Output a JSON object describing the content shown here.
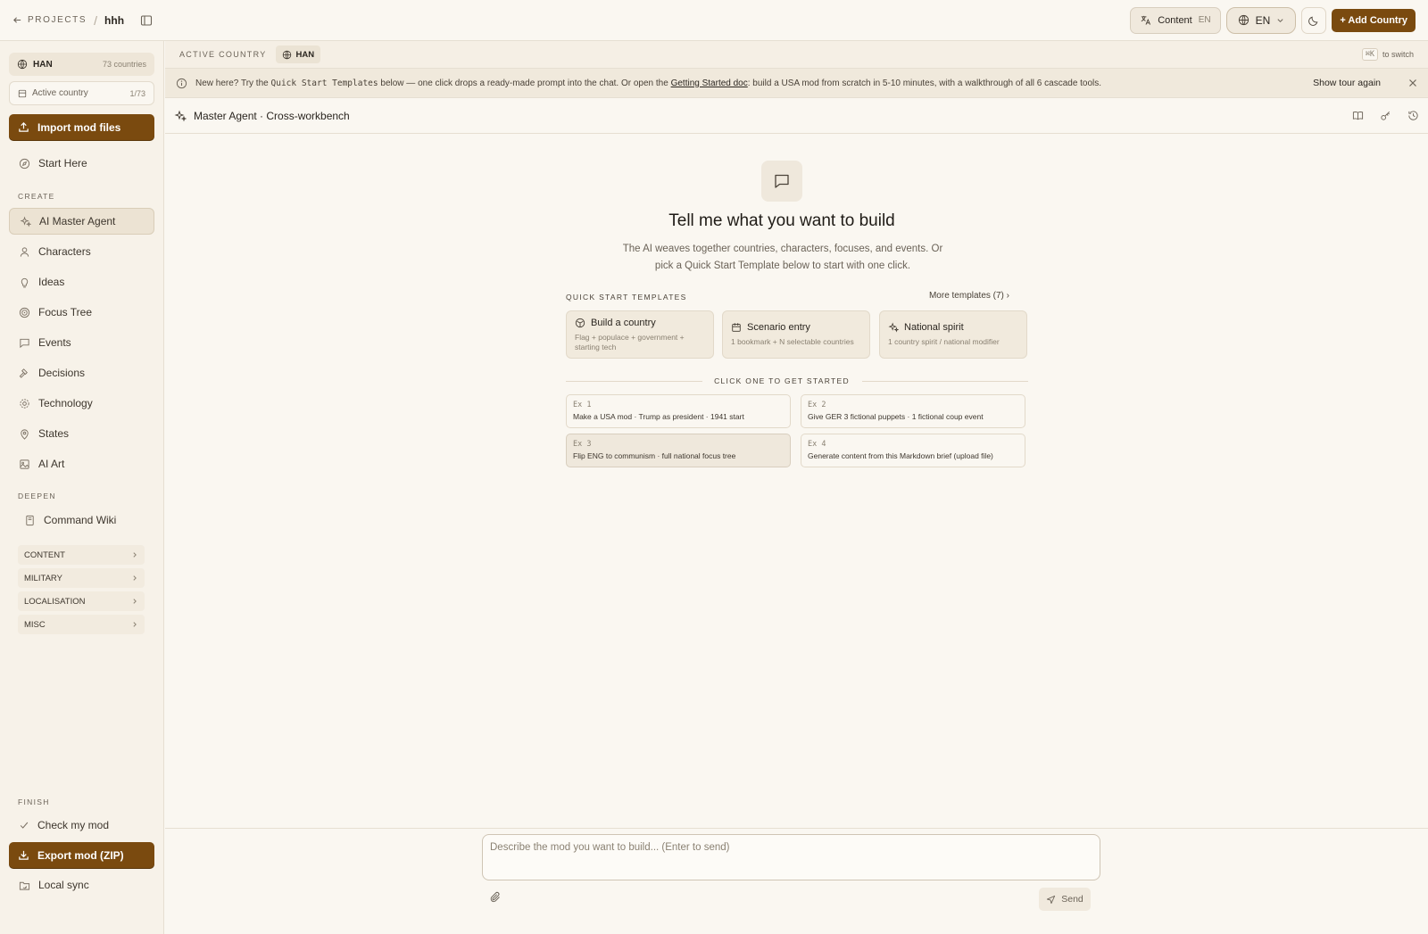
{
  "topbar": {
    "back_label": "PROJECTS",
    "project_name": "hhh",
    "content_label": "Content",
    "content_lang": "EN",
    "lang_label": "EN",
    "add_country_label": "+ Add Country"
  },
  "sidebar": {
    "country_code": "HAN",
    "country_count": "73 countries",
    "active_country_label": "Active country",
    "active_country_fraction": "1/73",
    "import_label": "Import mod files",
    "start_here_label": "Start Here",
    "create_label": "CREATE",
    "create_items": [
      {
        "label": "AI Master Agent",
        "icon": "sparkles-icon"
      },
      {
        "label": "Characters",
        "icon": "person-icon"
      },
      {
        "label": "Ideas",
        "icon": "lightbulb-icon"
      },
      {
        "label": "Focus Tree",
        "icon": "target-icon"
      },
      {
        "label": "Events",
        "icon": "message-icon"
      },
      {
        "label": "Decisions",
        "icon": "gavel-icon"
      },
      {
        "label": "Technology",
        "icon": "gear-icon"
      },
      {
        "label": "States",
        "icon": "map-pin-icon"
      },
      {
        "label": "AI Art",
        "icon": "image-icon"
      }
    ],
    "deepen_label": "DEEPEN",
    "command_wiki_label": "Command Wiki",
    "groups": [
      "CONTENT",
      "MILITARY",
      "LOCALISATION",
      "MISC"
    ],
    "finish_label": "FINISH",
    "check_label": "Check my mod",
    "export_label": "Export mod (ZIP)",
    "local_sync_label": "Local sync"
  },
  "strip": {
    "label": "ACTIVE COUNTRY",
    "chip": "HAN",
    "kbd": "⌘K",
    "hint": "to switch"
  },
  "banner": {
    "text_1": "New here? Try the",
    "code": "Quick Start Templates",
    "text_2": "below — one click drops a ready-made prompt into the chat. Or open the",
    "link": "Getting Started doc",
    "text_3": ": build a USA mod from scratch in 5-10 minutes, with a walkthrough of all 6 cascade tools.",
    "tour_label": "Show tour again"
  },
  "agent": {
    "title": "Master Agent · Cross-workbench"
  },
  "hero": {
    "title": "Tell me what you want to build",
    "subtitle": "The AI weaves together countries, characters, focuses, and events. Or pick a Quick Start Template below to start with one click."
  },
  "quick_start": {
    "label": "QUICK START TEMPLATES",
    "more_label": "More templates (7) ›",
    "templates": [
      {
        "title": "Build a country",
        "desc": "Flag + populace + government + starting tech",
        "icon": "box-icon"
      },
      {
        "title": "Scenario entry",
        "desc": "1 bookmark + N selectable countries",
        "icon": "calendar-icon"
      },
      {
        "title": "National spirit",
        "desc": "1 country spirit / national modifier",
        "icon": "sparkles-icon"
      }
    ],
    "divider_label": "CLICK ONE TO GET STARTED",
    "examples": [
      {
        "num": "Ex 1",
        "prompt": "Make a USA mod · Trump as president · 1941 start"
      },
      {
        "num": "Ex 2",
        "prompt": "Give GER 3 fictional puppets · 1 fictional coup event"
      },
      {
        "num": "Ex 3",
        "prompt": "Flip ENG to communism · full national focus tree"
      },
      {
        "num": "Ex 4",
        "prompt": "Generate content from this Markdown brief (upload file)"
      }
    ]
  },
  "composer": {
    "placeholder": "Describe the mod you want to build... (Enter to send)",
    "value": "",
    "send_label": "Send"
  },
  "colors": {
    "accent": "#7a4a0f",
    "background": "#faf7f1",
    "sidebar": "#f7f2e9"
  }
}
